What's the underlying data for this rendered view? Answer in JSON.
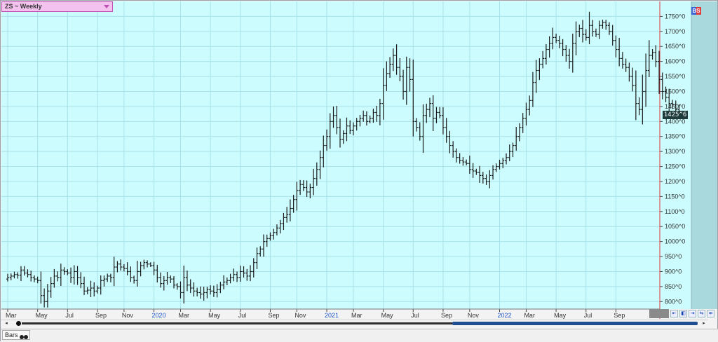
{
  "header": {
    "symbol_label": "ZS ~ Weekly",
    "bs_label": "BS"
  },
  "price_tag": "1425^6",
  "bottom": {
    "tab_label": "Bars",
    "scroll_left": "◂",
    "scroll_right": "▸"
  },
  "nav_buttons": [
    "⇤",
    "◧",
    "⇥",
    "⇆",
    "⇹"
  ],
  "colors": {
    "plot_background": "#ccfcfd",
    "grid": "#a8e2ea",
    "bars": "#1a1a1a",
    "cursor_line": "#e0353f",
    "year_label": "#1c55c8",
    "scale_background": "#ccfcfd",
    "scale_sidebar": "#a9d8dd"
  },
  "chart_data": {
    "type": "bar",
    "style": "ohlc",
    "title": "ZS ~ Weekly",
    "ylim": [
      775,
      1800
    ],
    "grid": true,
    "y_ticks": [
      "800^0",
      "850^0",
      "900^0",
      "950^0",
      "1000^0",
      "1050^0",
      "1100^0",
      "1150^0",
      "1200^0",
      "1250^0",
      "1300^0",
      "1350^0",
      "1400^0",
      "1450^0",
      "1500^0",
      "1550^0",
      "1600^0",
      "1650^0",
      "1700^0",
      "1750^0"
    ],
    "y_tick_values": [
      800,
      850,
      900,
      950,
      1000,
      1050,
      1100,
      1150,
      1200,
      1250,
      1300,
      1350,
      1400,
      1450,
      1500,
      1550,
      1600,
      1650,
      1700,
      1750
    ],
    "x_labels": [
      {
        "label": "Mar",
        "week": 0,
        "year": false
      },
      {
        "label": "May",
        "week": 9,
        "year": false
      },
      {
        "label": "Jul",
        "week": 18,
        "year": false
      },
      {
        "label": "Sep",
        "week": 27,
        "year": false
      },
      {
        "label": "Nov",
        "week": 35,
        "year": false
      },
      {
        "label": "2020",
        "week": 44,
        "year": true
      },
      {
        "label": "Mar",
        "week": 52,
        "year": false
      },
      {
        "label": "May",
        "week": 61,
        "year": false
      },
      {
        "label": "Jul",
        "week": 70,
        "year": false
      },
      {
        "label": "Sep",
        "week": 79,
        "year": false
      },
      {
        "label": "Nov",
        "week": 87,
        "year": false
      },
      {
        "label": "2021",
        "week": 96,
        "year": true
      },
      {
        "label": "Mar",
        "week": 104,
        "year": false
      },
      {
        "label": "May",
        "week": 113,
        "year": false
      },
      {
        "label": "Jul",
        "week": 122,
        "year": false
      },
      {
        "label": "Sep",
        "week": 131,
        "year": false
      },
      {
        "label": "Nov",
        "week": 139,
        "year": false
      },
      {
        "label": "2022",
        "week": 148,
        "year": true
      },
      {
        "label": "Mar",
        "week": 156,
        "year": false
      },
      {
        "label": "May",
        "week": 165,
        "year": false
      },
      {
        "label": "Jul",
        "week": 174,
        "year": false
      },
      {
        "label": "Sep",
        "week": 183,
        "year": false
      }
    ],
    "last_price": "1425^6",
    "closes": [
      880,
      885,
      890,
      888,
      905,
      895,
      890,
      880,
      875,
      870,
      820,
      800,
      835,
      860,
      885,
      880,
      905,
      900,
      895,
      880,
      900,
      880,
      860,
      835,
      838,
      845,
      835,
      845,
      870,
      875,
      885,
      880,
      915,
      925,
      915,
      910,
      900,
      880,
      870,
      900,
      920,
      930,
      925,
      920,
      905,
      880,
      860,
      870,
      880,
      875,
      855,
      850,
      830,
      880,
      855,
      845,
      835,
      830,
      825,
      830,
      840,
      835,
      830,
      840,
      855,
      865,
      870,
      880,
      890,
      880,
      900,
      895,
      885,
      900,
      930,
      960,
      975,
      1000,
      1010,
      1020,
      1030,
      1045,
      1060,
      1080,
      1090,
      1110,
      1140,
      1170,
      1190,
      1180,
      1165,
      1180,
      1210,
      1240,
      1280,
      1320,
      1350,
      1400,
      1420,
      1380,
      1340,
      1360,
      1385,
      1370,
      1385,
      1400,
      1410,
      1420,
      1400,
      1410,
      1430,
      1420,
      1460,
      1520,
      1560,
      1590,
      1620,
      1580,
      1550,
      1500,
      1580,
      1540,
      1400,
      1380,
      1350,
      1420,
      1440,
      1460,
      1410,
      1430,
      1420,
      1380,
      1350,
      1320,
      1300,
      1280,
      1270,
      1265,
      1260,
      1240,
      1235,
      1230,
      1220,
      1210,
      1200,
      1220,
      1240,
      1250,
      1260,
      1270,
      1280,
      1300,
      1320,
      1350,
      1380,
      1410,
      1440,
      1470,
      1530,
      1570,
      1590,
      1610,
      1640,
      1660,
      1680,
      1670,
      1660,
      1640,
      1620,
      1600,
      1660,
      1700,
      1710,
      1690,
      1680,
      1720,
      1700,
      1690,
      1720,
      1730,
      1720,
      1700,
      1670,
      1640,
      1610,
      1590,
      1580,
      1550,
      1520,
      1460,
      1440,
      1500,
      1570,
      1620,
      1630,
      1600,
      1540,
      1500,
      1480,
      1460,
      1455,
      1440,
      1425
    ]
  }
}
